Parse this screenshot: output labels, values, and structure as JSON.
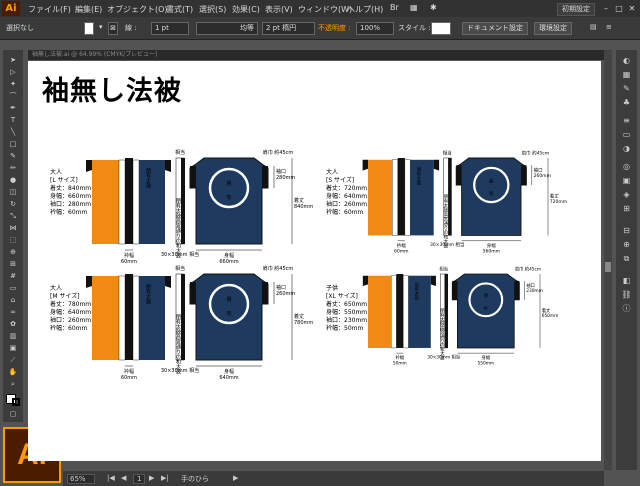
{
  "app": {
    "logo": "Ai",
    "workspace": "初期設定"
  },
  "menu": [
    "ファイル(F)",
    "編集(E)",
    "オブジェクト(O)",
    "書式(T)",
    "選択(S)",
    "効果(C)",
    "表示(V)",
    "ウィンドウ(W)",
    "ヘルプ(H)"
  ],
  "control": {
    "selection": "選択なし",
    "stroke_label": "線 :",
    "stroke_width": "1 pt",
    "profile": "均等",
    "brush": "2 pt 楕円",
    "opacity_label": "不透明度 :",
    "opacity": "100%",
    "style_label": "スタイル :",
    "doc_setup": "ドキュメント設定",
    "prefs": "環境設定"
  },
  "doc_tab": "袖無し法被.ai @ 64.99% (CMYK/プレビュー)",
  "status": {
    "zoom": "65%",
    "page": "1",
    "tool": "手のひら"
  },
  "artboard": {
    "title": "袖無し法被",
    "orange": "#f08a12",
    "navy": "#1e3a5f",
    "crest_text": "朋有",
    "back_text": "朋有太鼓",
    "side_text": "朋有太鼓高宮通りの和太鼓",
    "lbl_eri": "衿幅",
    "lbl_side": "30×30mm 相当",
    "lbl_fold": "相当",
    "lbl_kata": "肩巾 約45cm",
    "lbl_sodeguchi": "袖口",
    "lbl_mitake": "着丈",
    "lbl_mihaba": "身幅",
    "sets": [
      {
        "size_title": "大人",
        "size_name": "[L サイズ]",
        "lines": [
          "着丈：840mm",
          "身幅：660mm",
          "袖口：280mm",
          "衿幅：60mm"
        ],
        "eri_mm": "60mm",
        "sode_mm": "280mm",
        "length_mm": "840mm",
        "width_mm": "660mm"
      },
      {
        "size_title": "大人",
        "size_name": "[S サイズ]",
        "lines": [
          "着丈：720mm",
          "身幅：640mm",
          "袖口：260mm",
          "衿幅：60mm"
        ],
        "eri_mm": "60mm",
        "sode_mm": "260mm",
        "length_mm": "720mm",
        "width_mm": "560mm"
      },
      {
        "size_title": "大人",
        "size_name": "[M サイズ]",
        "lines": [
          "着丈：780mm",
          "身幅：640mm",
          "袖口：260mm",
          "衿幅：60mm"
        ],
        "eri_mm": "60mm",
        "sode_mm": "260mm",
        "length_mm": "780mm",
        "width_mm": "640mm"
      },
      {
        "size_title": "子供",
        "size_name": "[XL サイズ]",
        "lines": [
          "着丈：650mm",
          "身幅：550mm",
          "袖口：230mm",
          "衿幅：50mm"
        ],
        "eri_mm": "50mm",
        "sode_mm": "230mm",
        "length_mm": "650mm",
        "width_mm": "550mm"
      }
    ]
  }
}
